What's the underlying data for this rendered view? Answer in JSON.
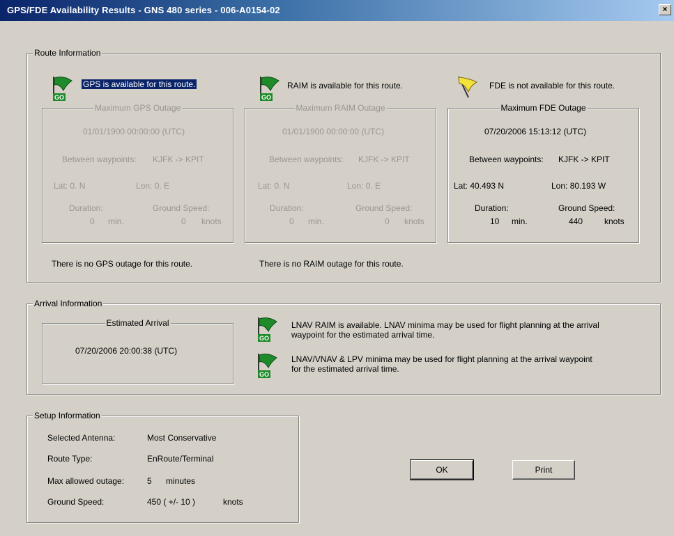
{
  "window": {
    "title": "GPS/FDE Availability Results - GNS 480 series - 006-A0154-02",
    "close_label": "×"
  },
  "route": {
    "legend": "Route Information",
    "gps": {
      "status": "GPS is available for this route.",
      "box_title": "Maximum GPS Outage",
      "date": "01/01/1900 00:00:00 (UTC)",
      "between_label": "Between waypoints:",
      "between_value": "KJFK -> KPIT",
      "lat": "Lat: 0. N",
      "lon": "Lon: 0. E",
      "duration_label": "Duration:",
      "duration_value": "0",
      "duration_unit": "min.",
      "speed_label": "Ground Speed:",
      "speed_value": "0",
      "speed_unit": "knots",
      "summary": "There is no GPS outage for this route."
    },
    "raim": {
      "status": "RAIM is available for this route.",
      "box_title": "Maximum RAIM Outage",
      "date": "01/01/1900 00:00:00 (UTC)",
      "between_label": "Between waypoints:",
      "between_value": "KJFK -> KPIT",
      "lat": "Lat: 0. N",
      "lon": "Lon: 0. E",
      "duration_label": "Duration:",
      "duration_value": "0",
      "duration_unit": "min.",
      "speed_label": "Ground Speed:",
      "speed_value": "0",
      "speed_unit": "knots",
      "summary": "There is no RAIM outage for this route."
    },
    "fde": {
      "status": "FDE is not available for this route.",
      "box_title": "Maximum FDE Outage",
      "date": "07/20/2006 15:13:12 (UTC)",
      "between_label": "Between waypoints:",
      "between_value": "KJFK -> KPIT",
      "lat": "Lat: 40.493 N",
      "lon": "Lon: 80.193 W",
      "duration_label": "Duration:",
      "duration_value": "10",
      "duration_unit": "min.",
      "speed_label": "Ground Speed:",
      "speed_value": "440",
      "speed_unit": "knots"
    }
  },
  "arrival": {
    "legend": "Arrival Information",
    "box_title": "Estimated Arrival",
    "date": "07/20/2006 20:00:38 (UTC)",
    "lnav_line1": "LNAV RAIM is available. LNAV minima may be used for flight planning at the arrival",
    "lnav_line2": "waypoint for the estimated arrival time.",
    "vnav_line1": "LNAV/VNAV & LPV minima may be used for flight planning at the arrival waypoint",
    "vnav_line2": "for the estimated arrival time."
  },
  "setup": {
    "legend": "Setup Information",
    "antenna_label": "Selected Antenna:",
    "antenna_value": "Most Conservative",
    "route_type_label": "Route Type:",
    "route_type_value": "EnRoute/Terminal",
    "outage_label": "Max allowed outage:",
    "outage_value": "5",
    "outage_unit": "minutes",
    "speed_label": "Ground Speed:",
    "speed_value": "450 ( +/- 10 )",
    "speed_unit": "knots"
  },
  "buttons": {
    "ok": "OK",
    "print": "Print"
  },
  "flags": {
    "go_text": "GO",
    "green": "#1f8a2a",
    "yellow": "#f2e23a"
  }
}
